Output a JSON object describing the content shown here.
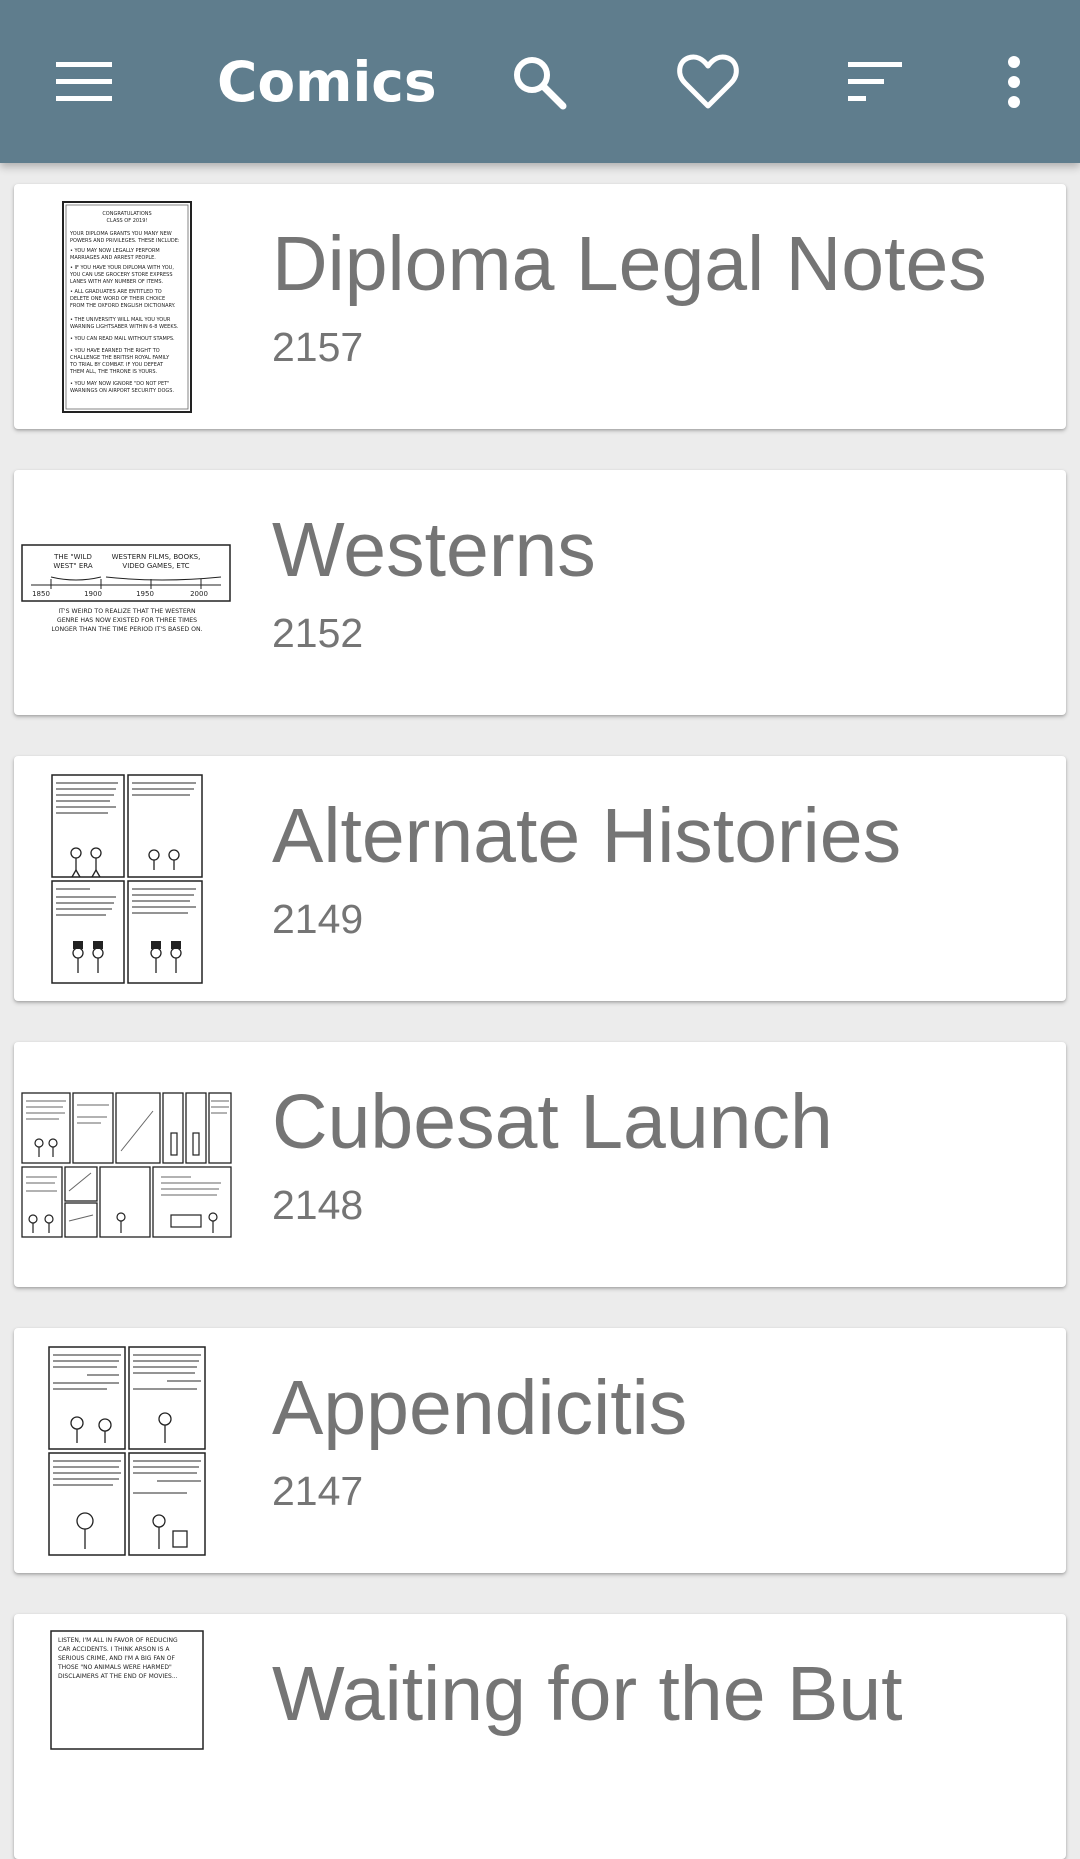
{
  "toolbar": {
    "title": "Comics",
    "icons": [
      "menu-icon",
      "search-icon",
      "favorite-heart-icon",
      "sort-icon",
      "more-vert-icon"
    ],
    "background_color": "#5f7d8d"
  },
  "comics": [
    {
      "title": "Diploma Legal Notes",
      "number": "2157",
      "thumbnail_text": [
        "CONGRATULATIONS",
        "CLASS OF 2019!",
        "YOUR DIPLOMA GRANTS YOU MANY NEW",
        "POWERS AND PRIVILEGES. THESE INCLUDE:",
        "• YOU MAY NOW LEGALLY PERFORM",
        "MARRIAGES AND ARREST PEOPLE.",
        "• IF YOU HAVE YOUR DIPLOMA WITH YOU,",
        "YOU CAN USE GROCERY STORE EXPRESS",
        "LANES WITH ANY NUMBER OF ITEMS.",
        "• ALL GRADUATES ARE ENTITLED TO",
        "DELETE ONE WORD OF THEIR CHOICE",
        "FROM THE OXFORD ENGLISH DICTIONARY.",
        "• THE UNIVERSITY WILL MAIL YOU YOUR",
        "WARNING LIGHTSABER WITHIN 6-8 WEEKS.",
        "• YOU CAN READ MAIL WITHOUT STAMPS.",
        "• YOU HAVE EARNED THE RIGHT TO",
        "CHALLENGE THE BRITISH ROYAL FAMILY",
        "TO TRIAL BY COMBAT. IF YOU DEFEAT",
        "THEM ALL, THE THRONE IS YOURS.",
        "• YOU MAY NOW IGNORE \"DO NOT PET\"",
        "WARNINGS ON AIRPORT SECURITY DOGS."
      ]
    },
    {
      "title": "Westerns",
      "number": "2152",
      "thumbnail_text": [
        "THE \"WILD",
        "WEST\" ERA",
        "WESTERN FILMS, BOOKS,",
        "VIDEO GAMES, ETC",
        "1850",
        "1900",
        "1950",
        "2000",
        "IT'S WEIRD TO REALIZE THAT THE WESTERN",
        "GENRE HAS NOW EXISTED FOR THREE TIMES",
        "LONGER THAN THE TIME PERIOD IT'S BASED ON."
      ]
    },
    {
      "title": "Alternate Histories",
      "number": "2149",
      "thumbnail_text": []
    },
    {
      "title": "Cubesat Launch",
      "number": "2148",
      "thumbnail_text": []
    },
    {
      "title": "Appendicitis",
      "number": "2147",
      "thumbnail_text": []
    },
    {
      "title": "Waiting for the But",
      "number": "",
      "thumbnail_text": [
        "LISTEN, I'M ALL IN FAVOR OF REDUCING",
        "CAR ACCIDENTS. I THINK ARSON IS A",
        "SERIOUS CRIME, AND I'M A BIG FAN OF",
        "THOSE \"NO ANIMALS WERE HARMED\"",
        "DISCLAIMERS AT THE END OF MOVIES..."
      ]
    }
  ]
}
